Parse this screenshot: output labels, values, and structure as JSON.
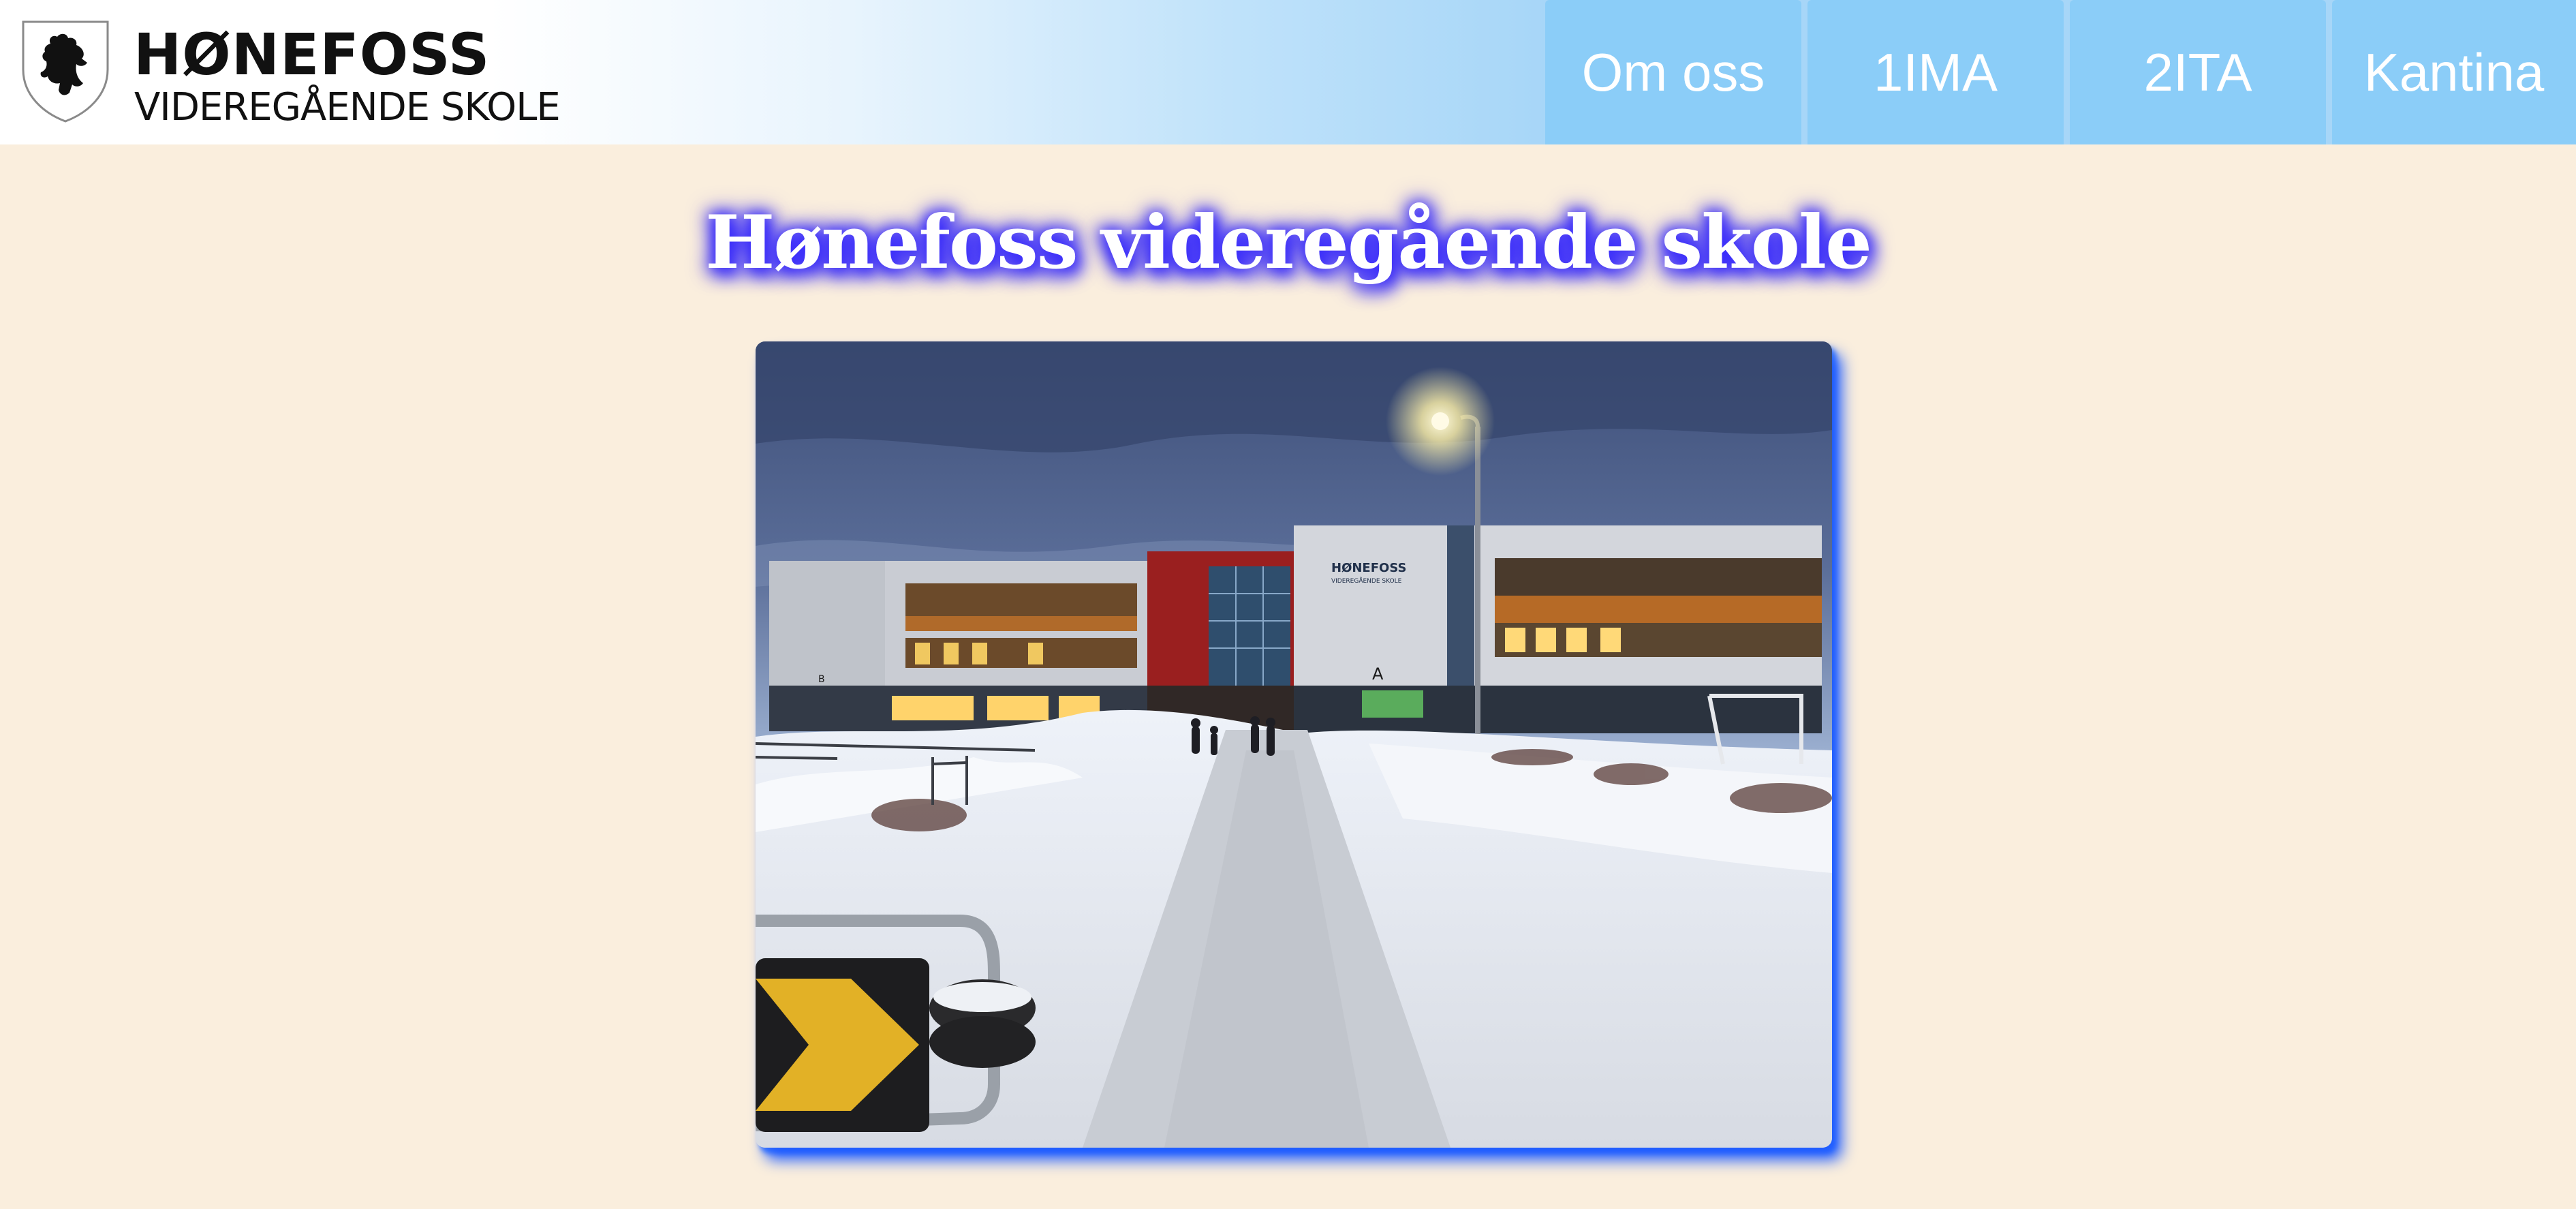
{
  "logo": {
    "name": "HØNEFOSS",
    "subtitle": "VIDEREGÅENDE SKOLE"
  },
  "nav": {
    "items": [
      {
        "label": "Om oss"
      },
      {
        "label": "1IMA"
      },
      {
        "label": "2ITA"
      },
      {
        "label": "Kantina"
      }
    ]
  },
  "main": {
    "title": "Hønefoss videregående skole",
    "photo": {
      "sign_name": "HØNEFOSS",
      "sign_sub": "VIDEREGÅENDE SKOLE",
      "label_a": "A",
      "label_b": "B"
    }
  },
  "colors": {
    "background": "#faeedd",
    "nav": "#8bcdf8",
    "title_glow": "#3a2dff",
    "photo_shadow": "#1f5cff"
  }
}
